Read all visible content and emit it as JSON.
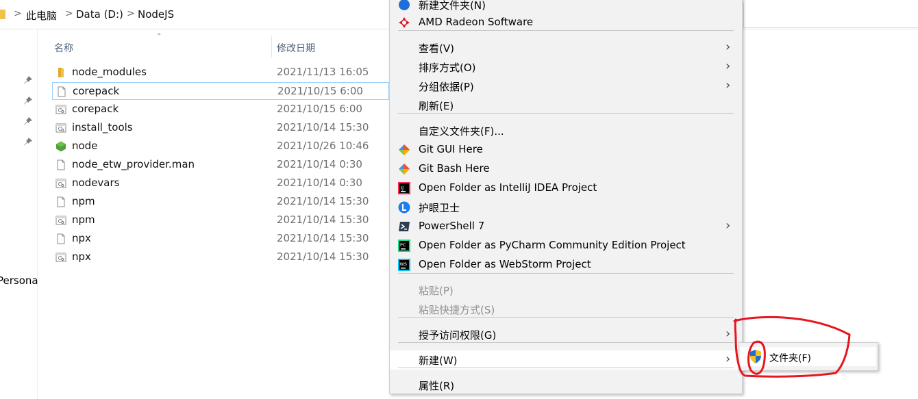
{
  "breadcrumb": [
    "此电脑",
    "Data (D:)",
    "NodeJS"
  ],
  "nav_pane": {
    "partial_label": "Persona"
  },
  "columns": {
    "name": "名称",
    "date": "修改日期"
  },
  "files": [
    {
      "name": "node_modules",
      "date": "2021/11/13 16:05",
      "icon": "folder-icon"
    },
    {
      "name": "corepack",
      "date": "2021/10/15 6:00",
      "icon": "file-icon",
      "selected": true
    },
    {
      "name": "corepack",
      "date": "2021/10/15 6:00",
      "icon": "script-file-icon"
    },
    {
      "name": "install_tools",
      "date": "2021/10/14 15:30",
      "icon": "script-file-icon"
    },
    {
      "name": "node",
      "date": "2021/10/26 10:46",
      "icon": "nodejs-icon"
    },
    {
      "name": "node_etw_provider.man",
      "date": "2021/10/14 0:30",
      "icon": "file-icon"
    },
    {
      "name": "nodevars",
      "date": "2021/10/14 0:30",
      "icon": "script-file-icon"
    },
    {
      "name": "npm",
      "date": "2021/10/14 15:30",
      "icon": "file-icon"
    },
    {
      "name": "npm",
      "date": "2021/10/14 15:30",
      "icon": "script-file-icon"
    },
    {
      "name": "npx",
      "date": "2021/10/14 15:30",
      "icon": "file-icon"
    },
    {
      "name": "npx",
      "date": "2021/10/14 15:30",
      "icon": "script-file-icon"
    }
  ],
  "context_menu": {
    "items": [
      {
        "label": "新建文件夹(N)",
        "icon": "new-folder-icon"
      },
      {
        "label": "AMD Radeon Software",
        "icon": "amd-radeon-icon"
      },
      {
        "label": "查看(V)",
        "submenu": true
      },
      {
        "label": "排序方式(O)",
        "submenu": true
      },
      {
        "label": "分组依据(P)",
        "submenu": true
      },
      {
        "label": "刷新(E)"
      },
      {
        "label": "自定义文件夹(F)..."
      },
      {
        "label": "Git GUI Here",
        "icon": "git-icon"
      },
      {
        "label": "Git Bash Here",
        "icon": "git-icon"
      },
      {
        "label": "Open Folder as IntelliJ IDEA Project",
        "icon": "intellij-icon"
      },
      {
        "label": "护眼卫士",
        "icon": "eye-guard-icon"
      },
      {
        "label": "PowerShell 7",
        "icon": "powershell-icon",
        "submenu": true
      },
      {
        "label": "Open Folder as PyCharm Community Edition Project",
        "icon": "pycharm-icon"
      },
      {
        "label": "Open Folder as WebStorm Project",
        "icon": "webstorm-icon"
      },
      {
        "label": "粘贴(P)",
        "disabled": true
      },
      {
        "label": "粘贴快捷方式(S)",
        "disabled": true
      },
      {
        "label": "授予访问权限(G)",
        "submenu": true
      },
      {
        "label": "新建(W)",
        "submenu": true,
        "hover": true
      },
      {
        "label": "属性(R)"
      }
    ]
  },
  "submenu": {
    "label": "文件夹(F)",
    "icon": "uac-shield-icon"
  },
  "colors": {
    "selection_border": "#99d1ff",
    "menu_bg": "#f2f2f2",
    "annotation": "#e8141e",
    "folder": "#f0c14b",
    "node_green": "#539e43"
  }
}
